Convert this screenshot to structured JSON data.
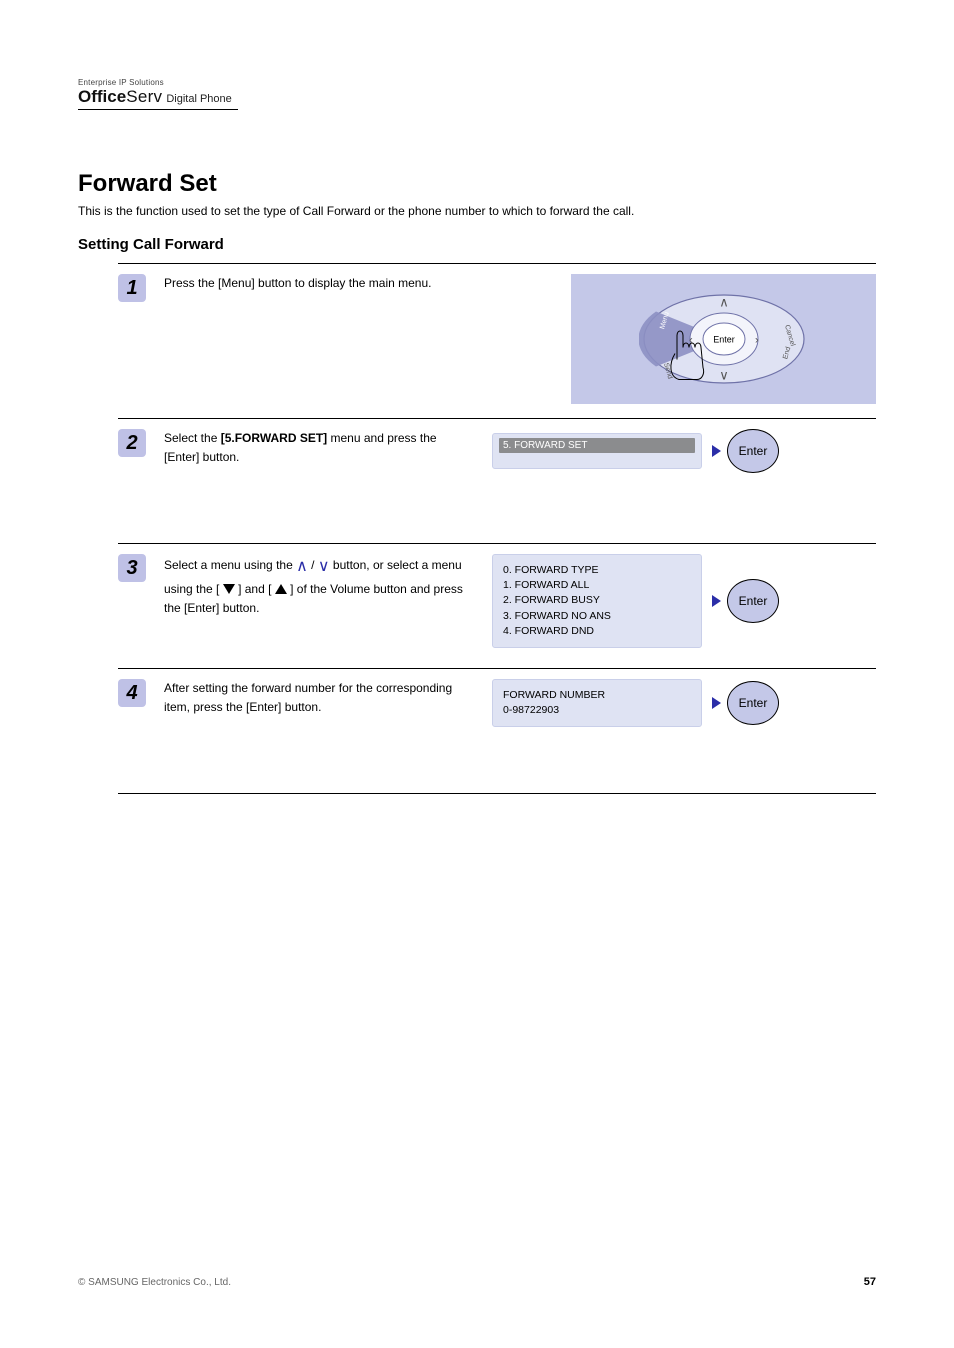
{
  "logo": {
    "tagline": "Enterprise IP Solutions",
    "brand_bold": "Office",
    "brand_light": "Serv",
    "sub": "Digital Phone"
  },
  "section": {
    "title": "Forward Set",
    "description": "This is the function used to set the type of Call Forward or the phone number to which to forward the call."
  },
  "subheads": {
    "setting": "Setting Call Forward"
  },
  "steps": {
    "s1": {
      "num": "1",
      "text": "Press the [Menu] button to display the main menu."
    },
    "s2": {
      "num": "2",
      "text_pre": "Select the ",
      "menu": "[5.FORWARD SET]",
      "text_post": " menu and press the [Enter] button.",
      "lcd": "5. FORWARD SET"
    },
    "s3": {
      "num": "3",
      "text_a": "Select a menu using the ",
      "text_b": "/",
      "text_c": " button, or select a menu using the [",
      "text_d": "] and [",
      "text_e": "] of the Volume button and press the [Enter] button.",
      "lcd_items": [
        "0. FORWARD TYPE",
        "1. FORWARD ALL",
        "2. FORWARD BUSY",
        "3. FORWARD NO ANS",
        "4. FORWARD DND"
      ]
    },
    "s4": {
      "num": "4",
      "text": "After setting the forward number for the corresponding item, press the [Enter] button.",
      "lcd_line1": "FORWARD NUMBER",
      "lcd_line2": "0-98722903"
    }
  },
  "enter_label": "Enter",
  "navpad": {
    "menu": "Menu",
    "send": "Send",
    "cancel": "Cancel",
    "end": "End",
    "enter": "Enter"
  },
  "footer": {
    "copyright": "© SAMSUNG Electronics Co., Ltd.",
    "page": "57"
  }
}
